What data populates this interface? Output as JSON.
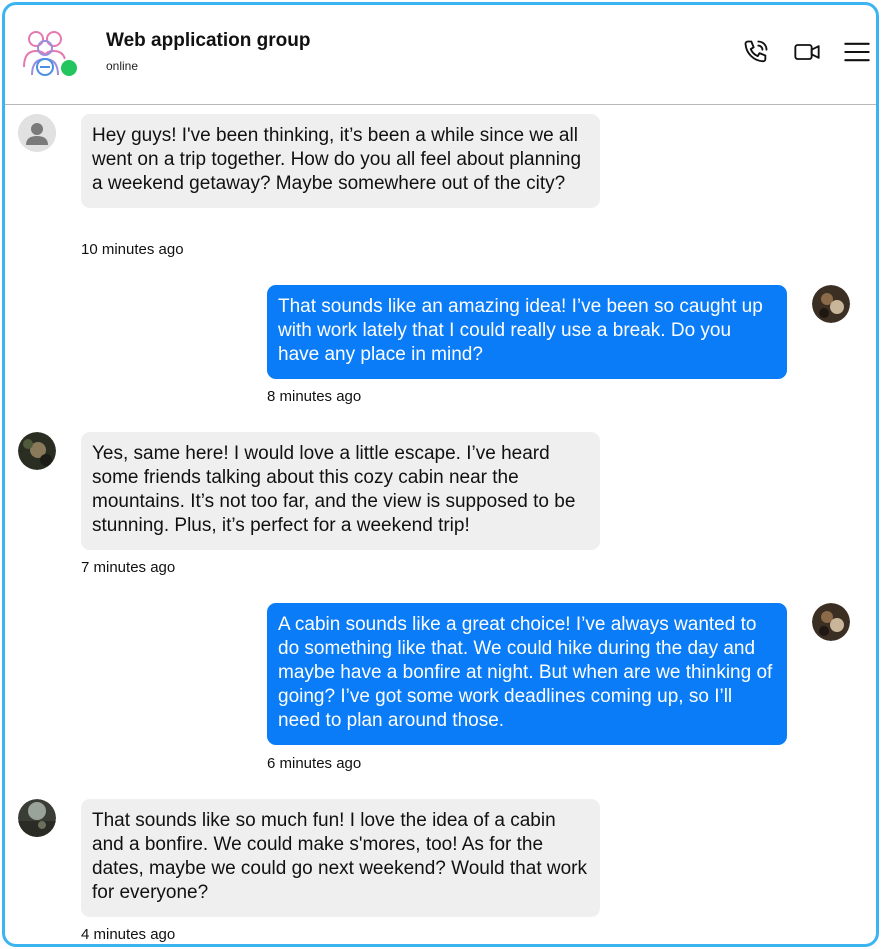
{
  "header": {
    "title": "Web application group",
    "status": "online",
    "icons": [
      "group-icon",
      "phone-icon",
      "video-icon",
      "menu-icon"
    ],
    "online_color": "#22c55e"
  },
  "colors": {
    "outgoing_bubble": "#0a7cf7",
    "incoming_bubble": "#efefef",
    "frame_border": "#3db4f2"
  },
  "messages": [
    {
      "direction": "incoming",
      "text": "Hey guys! I've been thinking, it’s been a while since we all went on a trip together. How do you all feel about planning a weekend getaway? Maybe somewhere out of the city?",
      "time": "10 minutes ago"
    },
    {
      "direction": "outgoing",
      "text": "That sounds like an amazing idea! I’ve been so caught up with work lately that I could really use a break. Do you have any place in mind?",
      "time": "8 minutes ago"
    },
    {
      "direction": "incoming",
      "text": "Yes, same here! I would love a little escape. I’ve heard some friends talking about this cozy cabin near the mountains. It’s not too far, and the view is supposed to be stunning. Plus, it’s perfect for a weekend trip!",
      "time": "7 minutes ago"
    },
    {
      "direction": "outgoing",
      "text": "A cabin sounds like a great choice! I’ve always wanted to do something like that. We could hike during the day and maybe have a bonfire at night. But when are we thinking of going? I’ve got some work deadlines coming up, so I’ll need to plan around those.",
      "time": "6 minutes ago"
    },
    {
      "direction": "incoming",
      "text": "That sounds like so much fun! I love the idea of a cabin and a bonfire. We could make s'mores, too! As for the dates, maybe we could go next weekend? Would that work for everyone?",
      "time": "4 minutes ago"
    }
  ]
}
